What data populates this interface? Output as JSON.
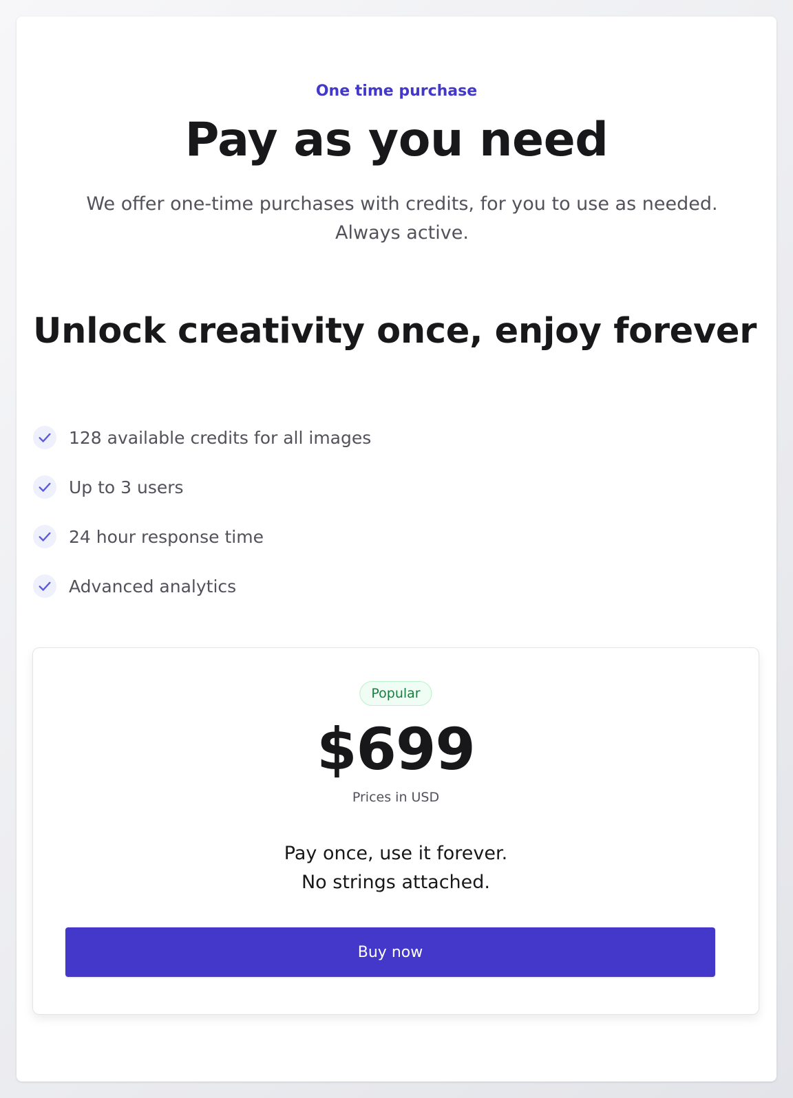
{
  "header": {
    "eyebrow": "One time purchase",
    "title": "Pay as you need",
    "subtitle_line1": "We offer one-time purchases with credits, for you to use as needed.",
    "subtitle_line2": "Always active."
  },
  "section": {
    "heading": "Unlock creativity once, enjoy forever"
  },
  "features": [
    {
      "label": "128 available credits for all images",
      "icon": "check-icon"
    },
    {
      "label": "Up to 3 users",
      "icon": "check-icon"
    },
    {
      "label": "24 hour response time",
      "icon": "check-icon"
    },
    {
      "label": "Advanced analytics",
      "icon": "check-icon"
    }
  ],
  "pricing": {
    "badge": "Popular",
    "price": "$699",
    "currency_note": "Prices in USD",
    "pitch_line1": "Pay once, use it forever.",
    "pitch_line2": "No strings attached.",
    "button_label": "Buy now"
  },
  "colors": {
    "accent": "#4338ca",
    "badge_text": "#15803d",
    "badge_bg": "#f0fdf4",
    "check_bg": "#eef0fb"
  }
}
